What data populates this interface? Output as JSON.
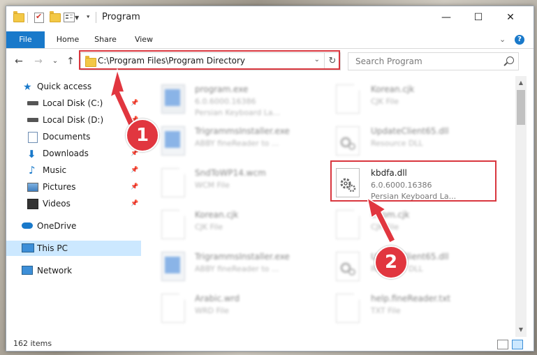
{
  "window": {
    "title": "Program",
    "controls": {
      "minimize": "—",
      "maximize": "☐",
      "close": "✕"
    }
  },
  "ribbon": {
    "tabs": [
      "File",
      "Home",
      "Share",
      "View"
    ],
    "expand_glyph": "⌄",
    "help_glyph": "?"
  },
  "nav": {
    "back_glyph": "←",
    "forward_glyph": "→",
    "recent_glyph": "⌄",
    "up_glyph": "↑",
    "address": "C:\\Program Files\\Program Directory",
    "address_dropdown_glyph": "⌄",
    "refresh_glyph": "↻",
    "search_placeholder": "Search Program"
  },
  "sidebar": {
    "items": [
      {
        "label": "Quick access",
        "icon": "star-icon",
        "color": "#1979ca"
      },
      {
        "label": "Local Disk (C:)",
        "icon": "drive-icon",
        "pinned": true
      },
      {
        "label": "Local Disk (D:)",
        "icon": "drive-icon",
        "pinned": true
      },
      {
        "label": "Documents",
        "icon": "documents-icon",
        "pinned": true
      },
      {
        "label": "Downloads",
        "icon": "download-icon",
        "pinned": true
      },
      {
        "label": "Music",
        "icon": "music-icon",
        "pinned": true
      },
      {
        "label": "Pictures",
        "icon": "pictures-icon",
        "pinned": true
      },
      {
        "label": "Videos",
        "icon": "videos-icon",
        "pinned": true
      },
      {
        "label": "OneDrive",
        "icon": "cloud-icon",
        "color": "#1979ca"
      },
      {
        "label": "This PC",
        "icon": "computer-icon",
        "selected": true
      },
      {
        "label": "Network",
        "icon": "network-icon"
      }
    ],
    "pin_glyph": "📌"
  },
  "files": [
    {
      "name": "program.exe",
      "line2": "6.0.6000.16386",
      "line3": "Persian Keyboard La...",
      "icon": "exe-icon",
      "blurred": true
    },
    {
      "name": "Korean.cjk",
      "line2": "CJK File",
      "line3": "",
      "icon": "document-icon",
      "blurred": true
    },
    {
      "name": "TrigrammsInstaller.exe",
      "line2": "ABBY fineReader to ...",
      "line3": "",
      "icon": "app-icon",
      "blurred": true
    },
    {
      "name": "UpdateClient65.dll",
      "line2": "Resource DLL",
      "line3": "",
      "icon": "dll-icon",
      "blurred": true
    },
    {
      "name": "SndToWP14.wcm",
      "line2": "WCM File",
      "line3": "",
      "icon": "document-icon",
      "blurred": true
    },
    {
      "name": "kbdfa.dll",
      "line2": "6.0.6000.16386",
      "line3": "Persian Keyboard La...",
      "icon": "dll-icon",
      "blurred": false
    },
    {
      "name": "Korean.cjk",
      "line2": "CJK File",
      "line3": "",
      "icon": "document-icon",
      "blurred": true
    },
    {
      "name": "CKom.cjk",
      "line2": "CJK File",
      "line3": "",
      "icon": "document-icon",
      "blurred": true
    },
    {
      "name": "TrigrammsInstaller.exe",
      "line2": "ABBY fineReader to ...",
      "line3": "",
      "icon": "app-icon",
      "blurred": true
    },
    {
      "name": "UpdateClient65.dll",
      "line2": "Resource DLL",
      "line3": "",
      "icon": "dll-icon",
      "blurred": true
    },
    {
      "name": "Arabic.wrd",
      "line2": "WRD File",
      "line3": "",
      "icon": "document-icon",
      "blurred": true
    },
    {
      "name": "help.fineReader.txt",
      "line2": "TXT File",
      "line3": "",
      "icon": "document-icon",
      "blurred": true
    }
  ],
  "scrollbar": {
    "up_glyph": "▲",
    "down_glyph": "▼"
  },
  "status": {
    "item_count": "162 items"
  },
  "annotations": {
    "step1": "1",
    "step2": "2",
    "highlight_color": "#d9363e",
    "badge_color": "#e1363f"
  }
}
